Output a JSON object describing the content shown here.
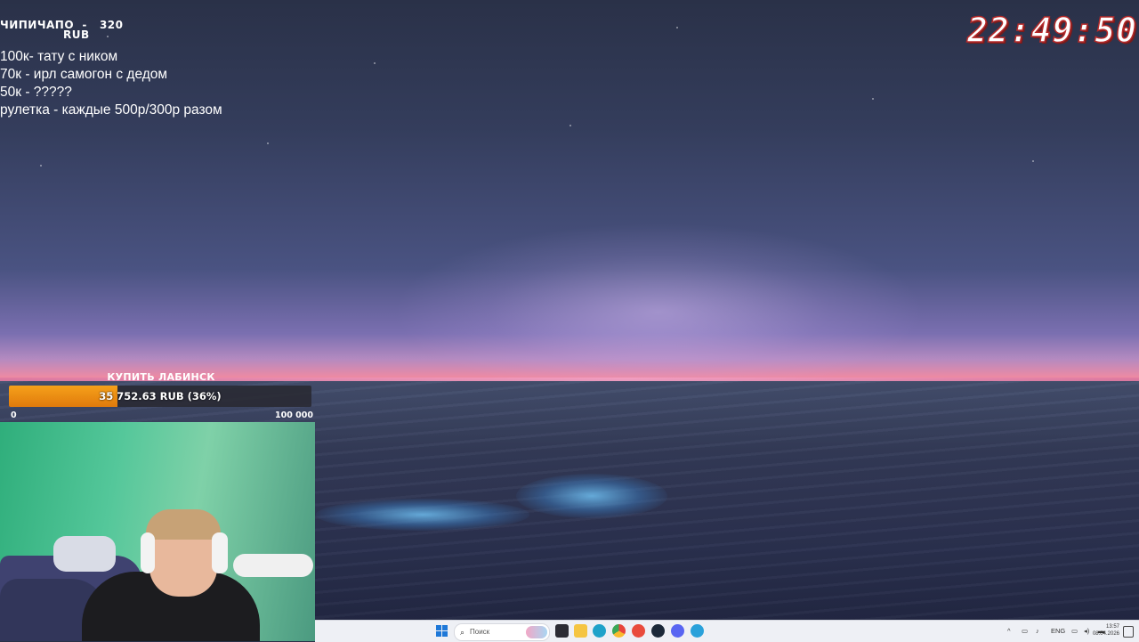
{
  "overlay": {
    "donor": {
      "name": "ЧИПИЧАПО",
      "separator": "-",
      "amount": "320",
      "currency": "RUB"
    },
    "goals_list": [
      "100к- тату с ником",
      "70к - ирл самогон с дедом",
      "50к - ?????",
      "рулетка - каждые 500р/300р разом"
    ],
    "clock": "22:49:50"
  },
  "goal_widget": {
    "title": "КУПИТЬ ЛАБИНСК",
    "amount_text": "35 752.63 RUB (36%)",
    "progress_fraction": 0.36,
    "min_label": "0",
    "max_label": "100 000",
    "fill_color": "#f39a16"
  },
  "taskbar": {
    "search_placeholder": "Поиск",
    "language": "ENG",
    "time": "13:57",
    "date": "08.04.2026",
    "apps": [
      "file-explorer-icon",
      "folder-icon",
      "edge-icon",
      "chrome-icon",
      "yandex-icon",
      "steam-icon",
      "discord-icon",
      "telegram-icon"
    ]
  },
  "colors": {
    "accent_orange": "#f39a16",
    "clock_outline": "#b52a2a",
    "horizon_pink": "#f08aa0"
  }
}
